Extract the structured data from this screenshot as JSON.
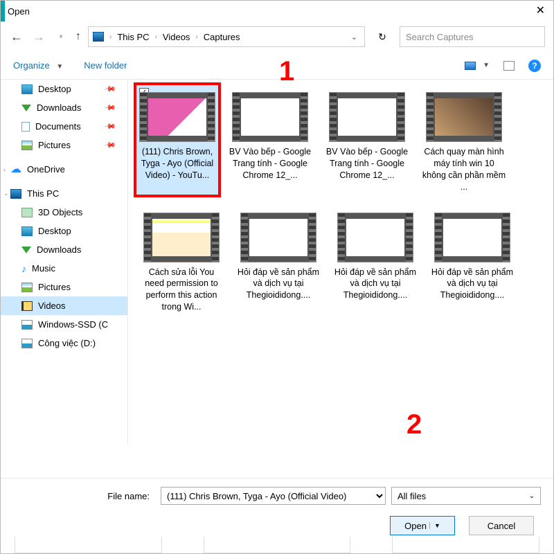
{
  "window": {
    "title": "Open"
  },
  "breadcrumb": {
    "root": "This PC",
    "l1": "Videos",
    "l2": "Captures"
  },
  "search": {
    "placeholder": "Search Captures"
  },
  "toolbar": {
    "organize": "Organize",
    "newfolder": "New folder"
  },
  "sidebar": {
    "desktop": "Desktop",
    "downloads": "Downloads",
    "documents": "Documents",
    "pictures": "Pictures",
    "onedrive": "OneDrive",
    "thispc": "This PC",
    "obj3d": "3D Objects",
    "desktop2": "Desktop",
    "downloads2": "Downloads",
    "music": "Music",
    "pictures2": "Pictures",
    "videos": "Videos",
    "winssd": "Windows-SSD (C",
    "congviec": "Công việc (D:)"
  },
  "files": [
    {
      "name": "(111) Chris Brown, Tyga - Ayo (Official Video) - YouTu..."
    },
    {
      "name": "BV Vào bếp - Google Trang tính - Google Chrome 12_..."
    },
    {
      "name": "BV Vào bếp - Google Trang tính - Google Chrome 12_..."
    },
    {
      "name": "Cách quay màn hình máy tính win 10 không cần phần mềm ..."
    },
    {
      "name": "Cách sửa lỗi You need permission to perform this action trong Wi..."
    },
    {
      "name": "Hỏi đáp về sản phẩm và dịch vụ tại Thegioididong...."
    },
    {
      "name": "Hỏi đáp về sản phẩm và dịch vụ tại Thegioididong...."
    },
    {
      "name": "Hỏi đáp về sản phẩm và dịch vụ tại Thegioididong...."
    }
  ],
  "footer": {
    "filename_label": "File name:",
    "filename_value": "(111) Chris Brown, Tyga - Ayo (Official Video)",
    "filter": "All files",
    "open": "Open",
    "cancel": "Cancel"
  },
  "annotations": {
    "one": "1",
    "two": "2"
  }
}
